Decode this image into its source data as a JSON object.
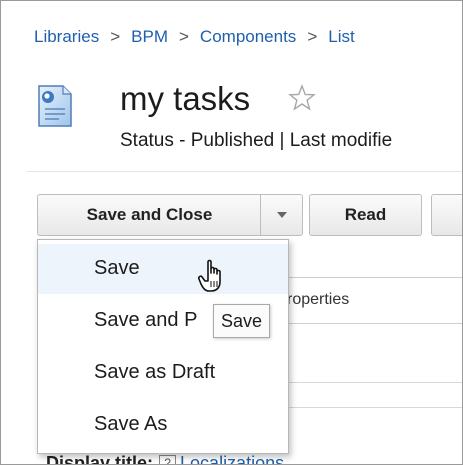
{
  "breadcrumb": {
    "items": [
      "Libraries",
      "BPM",
      "Components",
      "List"
    ],
    "separator": ">"
  },
  "header": {
    "title": "my tasks",
    "status_line": "Status - Published | Last modifie"
  },
  "toolbar": {
    "save_and_close_label": "Save and Close",
    "read_label": "Read"
  },
  "save_menu": {
    "items": [
      "Save",
      "Save and P",
      "Save as Draft",
      "Save As"
    ]
  },
  "tooltip": "Save",
  "tabs": {
    "properties_label": "roperties"
  },
  "form": {
    "display_title_label": "Display title:",
    "help_glyph": "?",
    "localizations_link": "Localizations"
  },
  "colors": {
    "link": "#1f5fae",
    "menu_hover": "#eef4fb",
    "button_border": "#bdbdbd"
  },
  "icons": [
    "document-icon",
    "star-icon",
    "chevron-down-icon",
    "hand-cursor-icon",
    "help-icon"
  ]
}
